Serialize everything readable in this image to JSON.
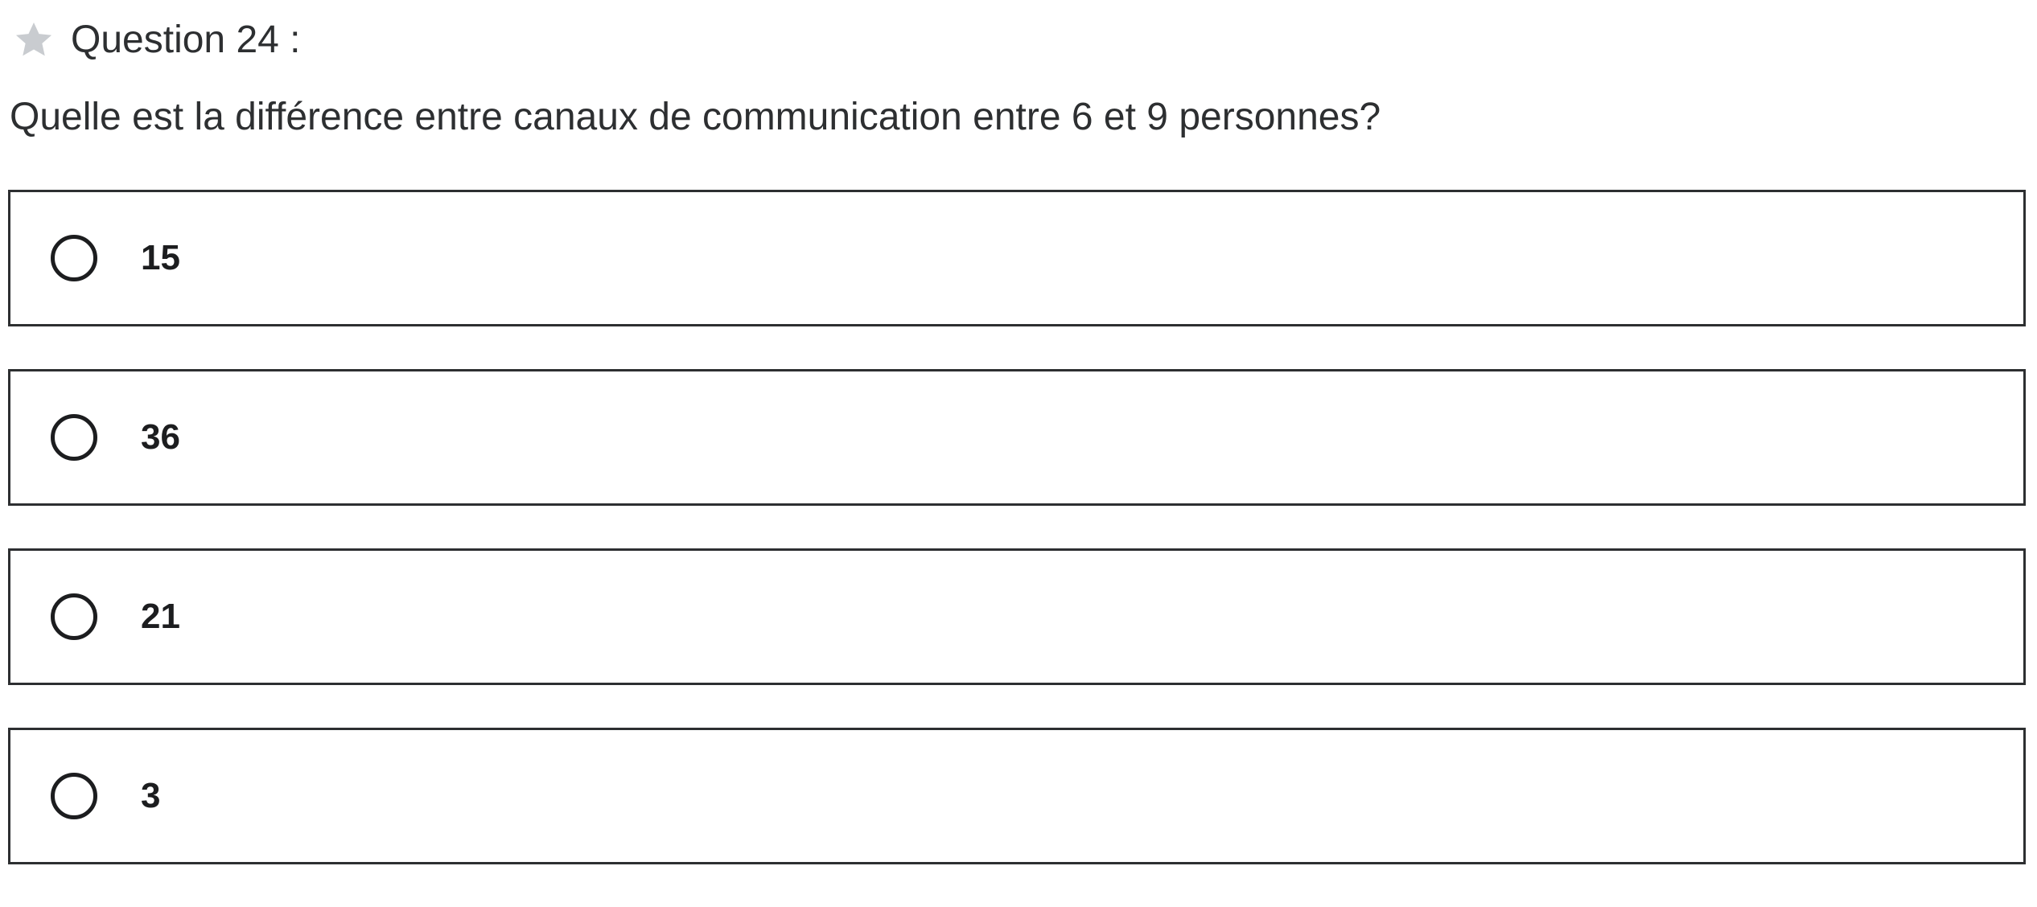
{
  "question": {
    "number_label": "Question 24 :",
    "star_icon": "star-icon",
    "star_color": "#c9ccd0",
    "prompt": "Quelle est la différence entre canaux de communication entre 6 et 9 personnes?"
  },
  "options": [
    {
      "label": "15",
      "selected": false
    },
    {
      "label": "36",
      "selected": false
    },
    {
      "label": "21",
      "selected": false
    },
    {
      "label": "3",
      "selected": false
    }
  ]
}
